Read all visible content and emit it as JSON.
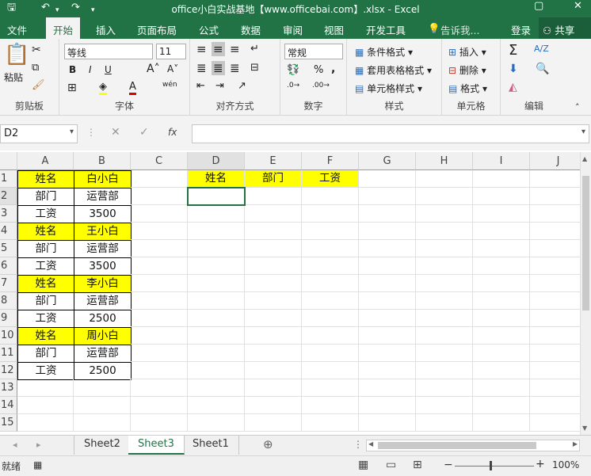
{
  "window": {
    "title": "office小白实战基地【www.officebai.com】.xlsx - Excel",
    "min_icon": "minimize-icon",
    "restore_icon": "restore-icon",
    "close_icon": "close-icon"
  },
  "qat": {
    "save_icon": "save-icon",
    "undo_icon": "undo-icon",
    "redo_icon": "redo-icon",
    "customize_icon": "customize-icon"
  },
  "tabs": [
    "文件",
    "开始",
    "插入",
    "页面布局",
    "公式",
    "数据",
    "审阅",
    "视图",
    "开发工具"
  ],
  "active_tab": "开始",
  "tell_me": "告诉我...",
  "login": "登录",
  "share": "共享",
  "ribbon": {
    "clipboard": {
      "label": "剪贴板",
      "paste": "粘贴"
    },
    "font": {
      "label": "字体",
      "name": "等线",
      "size": "11",
      "bold": "B",
      "italic": "I",
      "underline": "U",
      "wen": "wén"
    },
    "alignment": {
      "label": "对齐方式"
    },
    "number": {
      "label": "数字",
      "format": "常规",
      "percent": "%",
      "comma": ","
    },
    "styles": {
      "label": "样式",
      "conditional": "条件格式",
      "table": "套用表格格式",
      "cell": "单元格样式"
    },
    "cells": {
      "label": "单元格",
      "insert": "插入",
      "delete": "删除",
      "format": "格式"
    },
    "editing": {
      "label": "编辑",
      "sum": "Σ",
      "sort": "A/Z"
    }
  },
  "formula_bar": {
    "name_box": "D2",
    "cancel": "✕",
    "enter": "✓",
    "fx": "fx",
    "value": ""
  },
  "columns": [
    "A",
    "B",
    "C",
    "D",
    "E",
    "F",
    "G",
    "H",
    "I",
    "J"
  ],
  "rows": [
    "1",
    "2",
    "3",
    "4",
    "5",
    "6",
    "7",
    "8",
    "9",
    "10",
    "11",
    "12",
    "13",
    "14",
    "15"
  ],
  "cells": {
    "A1": "姓名",
    "B1": "白小白",
    "A2": "部门",
    "B2": "运营部",
    "A3": "工资",
    "B3": "3500",
    "A4": "姓名",
    "B4": "王小白",
    "A5": "部门",
    "B5": "运营部",
    "A6": "工资",
    "B6": "3500",
    "A7": "姓名",
    "B7": "李小白",
    "A8": "部门",
    "B8": "运营部",
    "A9": "工资",
    "B9": "2500",
    "A10": "姓名",
    "B10": "周小白",
    "A11": "部门",
    "B11": "运营部",
    "A12": "工资",
    "B12": "2500",
    "D1": "姓名",
    "E1": "部门",
    "F1": "工资"
  },
  "highlight_color": "#ffff00",
  "sheets": [
    "Sheet2",
    "Sheet3",
    "Sheet1"
  ],
  "active_sheet": "Sheet3",
  "add_sheet_icon": "plus-circle-icon",
  "status": {
    "ready": "就绪",
    "zoom": "100%",
    "zoom_out": "−",
    "zoom_in": "+"
  },
  "accent_color": "#217346"
}
